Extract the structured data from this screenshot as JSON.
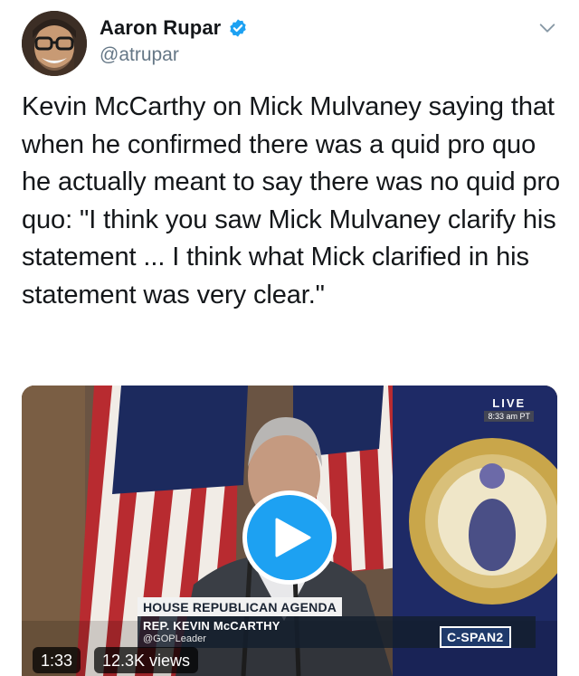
{
  "author": {
    "display_name": "Aaron Rupar",
    "handle": "@atrupar",
    "avatar_icon": "user-avatar-glasses",
    "verified_icon": "verified-badge-icon",
    "verified_color": "#1da1f2"
  },
  "menu": {
    "icon": "chevron-down-icon"
  },
  "tweet": {
    "text": "Kevin McCarthy on Mick Mulvaney saying that when he confirmed there was a quid pro quo he actually meant to say there was no quid pro quo: \"I think you saw Mick Mulvaney clarify his statement ... I think what Mick clarified in his statement was very clear.\""
  },
  "media": {
    "type": "video",
    "live_label": "LIVE",
    "live_time": "8:33 am PT",
    "lower_third_title": "HOUSE REPUBLICAN AGENDA",
    "lower_third_name": "REP. KEVIN McCARTHY",
    "lower_third_handle": "@GOPLeader",
    "network_logo": "C-SPAN2",
    "duration": "1:33",
    "views": "12.3K views",
    "play_icon": "play-icon",
    "play_color": "#1da1f2"
  }
}
